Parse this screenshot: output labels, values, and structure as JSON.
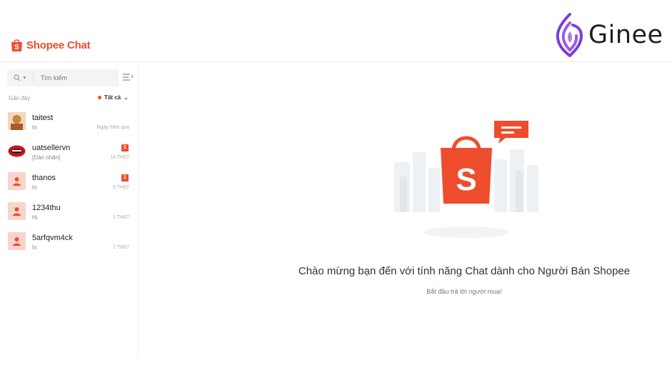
{
  "watermark": {
    "text": "Ginee"
  },
  "header": {
    "brand": "Shopee Chat"
  },
  "sidebar": {
    "search": {
      "placeholder": "Tìm kiếm"
    },
    "recent_label": "Gần đây",
    "filter_label": "Tất cả",
    "conversations": [
      {
        "name": "taitest",
        "message": "hi",
        "time": "Ngày hôm qua",
        "badge": ""
      },
      {
        "name": "uatsellervn",
        "message": "[Dán nhãn]",
        "time": "14 TH07",
        "badge": "1"
      },
      {
        "name": "thanos",
        "message": "hi",
        "time": "5 TH07",
        "badge": "1"
      },
      {
        "name": "1234thu",
        "message": "Hi",
        "time": "1 TH07",
        "badge": ""
      },
      {
        "name": "5arfqvm4ck",
        "message": "hi",
        "time": "1 TH07",
        "badge": ""
      }
    ]
  },
  "main": {
    "welcome_title": "Chào mừng bạn đến với tính năng Chat dành cho Người Bán Shopee",
    "welcome_subtitle": "Bắt đầu trả lời người mua!",
    "logo_letter": "S"
  },
  "colors": {
    "accent": "#ee4d2d",
    "ginee": "#7b3fd4"
  },
  "icons": [
    "ginee-logo-icon",
    "shopee-bag-icon",
    "search-icon",
    "filter-list-icon",
    "person-icon",
    "chat-bubble-icon"
  ]
}
